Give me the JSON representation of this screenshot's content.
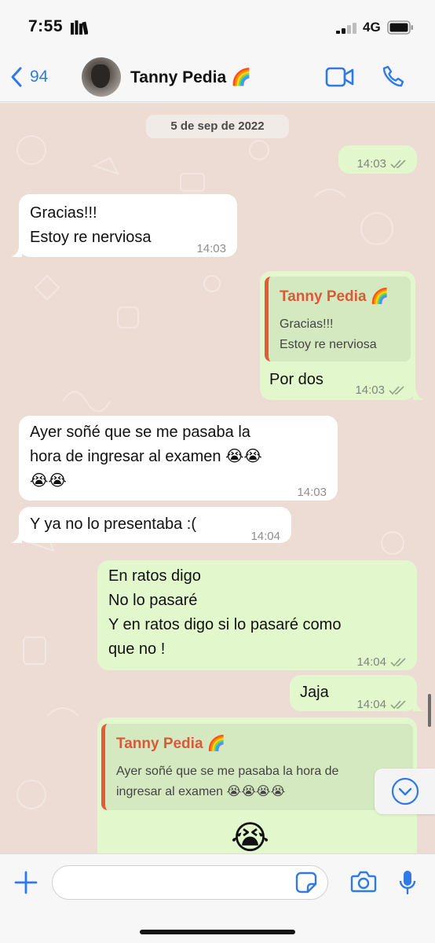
{
  "status_bar": {
    "time": "7:55",
    "network": "4G"
  },
  "header": {
    "back_count": "94",
    "contact_name": "Tanny Pedia 🌈",
    "icons": {
      "back": "chevron-left-icon",
      "video": "video-camera-icon",
      "call": "phone-icon"
    }
  },
  "chat": {
    "date_label": "5 de sep de 2022",
    "messages": [
      {
        "direction": "outgoing",
        "text": "",
        "time": "14:03",
        "read": true
      },
      {
        "direction": "incoming",
        "text": "Gracias!!!\nEstoy re nerviosa",
        "time": "14:03"
      },
      {
        "direction": "outgoing",
        "reply_to": {
          "name": "Tanny Pedia 🌈",
          "text": "Gracias!!!\nEstoy re nerviosa"
        },
        "text": "Por dos",
        "time": "14:03",
        "read": true
      },
      {
        "direction": "incoming",
        "text": "Ayer soñé que se me pasaba la\nhora de ingresar al examen 😭😭\n😭😭",
        "time": "14:03"
      },
      {
        "direction": "incoming",
        "text": "Y ya no lo presentaba :(",
        "time": "14:04"
      },
      {
        "direction": "outgoing",
        "text": "En ratos digo\nNo lo pasaré\nY en ratos digo si lo pasaré como\nque no !",
        "time": "14:04",
        "read": true
      },
      {
        "direction": "outgoing",
        "text": "Jaja",
        "time": "14:04",
        "read": true
      },
      {
        "direction": "outgoing",
        "reply_to": {
          "name": "Tanny Pedia 🌈",
          "text": "Ayer soñé que se me pasaba la hora de\ningresar al examen 😭😭😭😭"
        },
        "text": "😭",
        "time": ""
      }
    ],
    "tick_color": "#8fa387",
    "incoming_bubble_color": "#ffffff",
    "outgoing_bubble_color": "#e2f7cb",
    "reply_accent_color": "#e25b3b",
    "scroll_down_icon": "chevron-down-circle-icon"
  },
  "input_bar": {
    "placeholder": "",
    "icons": {
      "attach": "plus-icon",
      "sticker": "sticker-icon",
      "camera": "camera-icon",
      "mic": "microphone-icon"
    }
  },
  "accent_color": "#2f7ae5"
}
